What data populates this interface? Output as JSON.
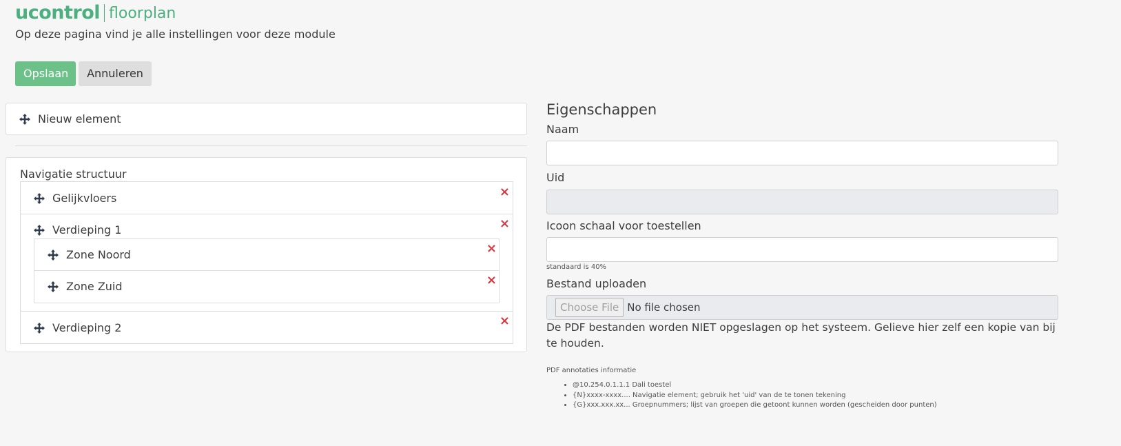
{
  "header": {
    "brand": "ucontrol",
    "module": "floorplan",
    "description": "Op deze pagina vind je alle instellingen voor deze module"
  },
  "toolbar": {
    "save_label": "Opslaan",
    "cancel_label": "Annuleren"
  },
  "new_element": {
    "label": "Nieuw element",
    "icon": "move-icon"
  },
  "navigation": {
    "title": "Navigatie structuur",
    "items": [
      {
        "label": "Gelijkvloers",
        "children": []
      },
      {
        "label": "Verdieping 1",
        "children": [
          {
            "label": "Zone Noord"
          },
          {
            "label": "Zone Zuid"
          }
        ]
      },
      {
        "label": "Verdieping 2",
        "children": []
      }
    ],
    "remove_glyph": "×"
  },
  "properties": {
    "title": "Eigenschappen",
    "name_label": "Naam",
    "name_value": "",
    "uid_label": "Uid",
    "uid_value": "",
    "icon_scale_label": "Icoon schaal voor toestellen",
    "icon_scale_value": "",
    "icon_scale_help": "standaard is 40%",
    "upload_label": "Bestand uploaden",
    "file_button": "Choose File",
    "file_status": "No file chosen",
    "pdf_note": "De PDF bestanden worden NIET opgeslagen op het systeem. Gelieve hier zelf een kopie van bij te houden.",
    "annotations_title": "PDF annotaties informatie",
    "annotations": [
      "@10.254.0.1.1.1 Dali toestel",
      "{N}xxxx-xxxx.... Navigatie element; gebruik het 'uid' van de te tonen tekening",
      "{G}xxx.xxx.xx... Groepnummers; lijst van groepen die getoont kunnen worden (gescheiden door punten)"
    ]
  },
  "colors": {
    "accent": "#4caf7f",
    "save_button": "#6cc189",
    "remove": "#d9373f"
  }
}
